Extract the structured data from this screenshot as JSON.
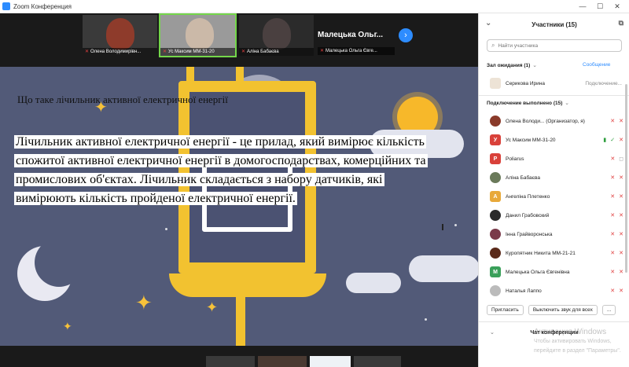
{
  "window": {
    "title": "Zoom Конференция",
    "controls": [
      "—",
      "☐",
      "✕"
    ]
  },
  "video_strip": {
    "participants": [
      {
        "name": "Олена Володимирівн...",
        "muted": true
      },
      {
        "name": "Ус Максим ММ-31-20",
        "muted": true
      },
      {
        "name": "Аліна Бабаєва",
        "muted": true
      }
    ],
    "featured_name": "Малецька Ольг...",
    "featured_tag": "Малецька Ольга Євге..."
  },
  "slide": {
    "title": "Що таке лічильник активної електричної енергії",
    "body_lines": [
      "Лічильник активної електричної енергії - це прилад, який вимірює кількість",
      "спожитої активної електричної енергії в домогосподарствах, комерційних та",
      "промислових об'єктах. Лічильник складається з набору датчиків, які",
      "вимірюють кількість пройденої електричної енергії."
    ]
  },
  "panel": {
    "title": "Участники (15)",
    "search_placeholder": "Найти участника",
    "waiting_label": "Зал ожидания (1)",
    "messages_link": "Сообщение",
    "waiting": [
      {
        "name": "Серикова Ирина",
        "status": "Подключение..."
      }
    ],
    "connected_label": "Подключение выполнено (15)",
    "participants": [
      {
        "name": "Олена Володи... (Организатор, я)",
        "avatar": "photo",
        "color": "#8a3a2a"
      },
      {
        "name": "Ус Максим ММ-31-20",
        "avatar": "У",
        "color": "#d9413a"
      },
      {
        "name": "Poliarus",
        "avatar": "P",
        "color": "#d9413a"
      },
      {
        "name": "Аліна Бабаєва",
        "avatar": "photo",
        "color": "#6a7a5a"
      },
      {
        "name": "Ангеліна Плетенко",
        "avatar": "А",
        "color": "#e8a93a"
      },
      {
        "name": "Данил Грабовский",
        "avatar": "photo",
        "color": "#2a2a2a"
      },
      {
        "name": "Інна Грайворонська",
        "avatar": "photo",
        "color": "#7a3a4a"
      },
      {
        "name": "Куропятник Никита ММ-21-21",
        "avatar": "photo",
        "color": "#5a2a1a"
      },
      {
        "name": "Малецька Ольга Євгенівна",
        "avatar": "M",
        "color": "#3aa05a"
      },
      {
        "name": "Наталья Лаппо",
        "avatar": "photo",
        "color": "#bbbbbb"
      }
    ],
    "buttons": {
      "invite": "Пригласить",
      "mute_all": "Выключить звук для всех",
      "more": "..."
    },
    "chat_label": "Чат конференции",
    "watermark_line1": "Активация Windows",
    "watermark_line2": "Чтобы активировать Windows, перейдите в раздел \"Параметры\"."
  }
}
